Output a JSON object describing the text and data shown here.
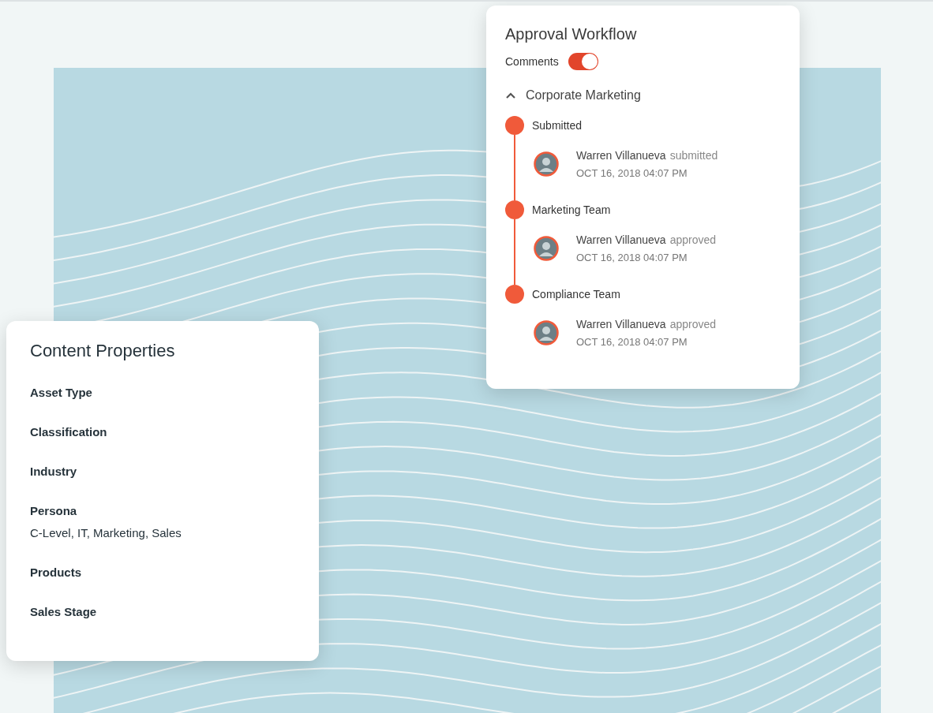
{
  "approval_workflow": {
    "title": "Approval Workflow",
    "comments_toggle": {
      "label": "Comments",
      "on": true
    },
    "group": {
      "name": "Corporate Marketing",
      "expanded": true,
      "steps": [
        {
          "name": "Submitted",
          "user": "Warren Villanueva",
          "action": "submitted",
          "timestamp": "OCT 16, 2018 04:07 PM"
        },
        {
          "name": "Marketing Team",
          "user": "Warren Villanueva",
          "action": "approved",
          "timestamp": "OCT 16, 2018 04:07 PM"
        },
        {
          "name": "Compliance Team",
          "user": "Warren Villanueva",
          "action": "approved",
          "timestamp": "OCT 16, 2018 04:07 PM"
        }
      ]
    }
  },
  "content_properties": {
    "title": "Content Properties",
    "fields": [
      {
        "label": "Asset Type"
      },
      {
        "label": "Classification"
      },
      {
        "label": "Industry"
      },
      {
        "label": "Persona",
        "value": "C-Level, IT, Marketing, Sales"
      },
      {
        "label": "Products"
      },
      {
        "label": "Sales Stage"
      }
    ]
  }
}
